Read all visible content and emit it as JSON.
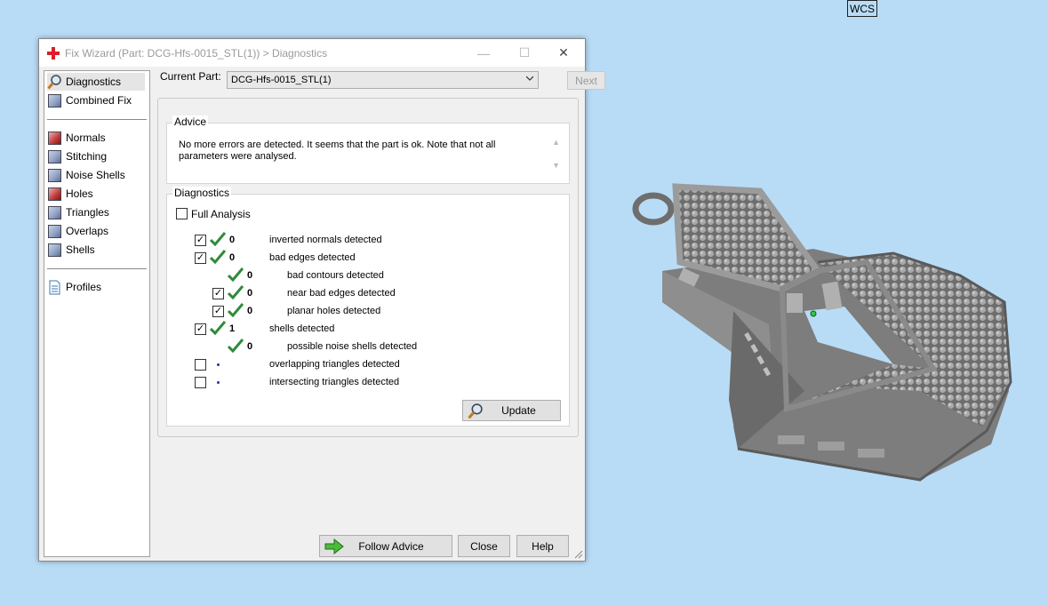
{
  "wcs_label": "WCS",
  "window": {
    "title": "Fix Wizard (Part: DCG-Hfs-0015_STL(1)) > Diagnostics",
    "minimize_glyph": "—",
    "maximize_glyph": "☐",
    "close_glyph": "✕"
  },
  "sidebar": {
    "items": [
      {
        "label": "Diagnostics",
        "icon": "magnifier-icon"
      },
      {
        "label": "Combined Fix",
        "icon": "cube-icon"
      },
      {
        "label": "Normals",
        "icon": "red-cube-icon"
      },
      {
        "label": "Stitching",
        "icon": "cube-icon"
      },
      {
        "label": "Noise Shells",
        "icon": "cube-icon"
      },
      {
        "label": "Holes",
        "icon": "red-cube-icon"
      },
      {
        "label": "Triangles",
        "icon": "cube-icon"
      },
      {
        "label": "Overlaps",
        "icon": "cube-icon"
      },
      {
        "label": "Shells",
        "icon": "cube-icon"
      },
      {
        "label": "Profiles",
        "icon": "document-icon"
      }
    ]
  },
  "current_part": {
    "label": "Current Part:",
    "value": "DCG-Hfs-0015_STL(1)",
    "next_label": "Next"
  },
  "advice": {
    "title": "Advice",
    "text": "No more errors are detected. It seems that the part is ok. Note that not all parameters were analysed."
  },
  "diagnostics": {
    "title": "Diagnostics",
    "full_analysis_label": "Full Analysis",
    "rows": [
      {
        "count": "0",
        "label": "inverted normals detected",
        "checked": true,
        "status": "ok"
      },
      {
        "count": "0",
        "label": "bad edges detected",
        "checked": true,
        "status": "ok"
      },
      {
        "count": "0",
        "label": "bad contours detected",
        "checked": null,
        "status": "ok"
      },
      {
        "count": "0",
        "label": "near bad edges detected",
        "checked": true,
        "status": "ok"
      },
      {
        "count": "0",
        "label": "planar holes detected",
        "checked": true,
        "status": "ok"
      },
      {
        "count": "1",
        "label": "shells detected",
        "checked": true,
        "status": "ok"
      },
      {
        "count": "0",
        "label": "possible noise shells detected",
        "checked": null,
        "status": "ok"
      },
      {
        "count": "",
        "label": "overlapping triangles detected",
        "checked": false,
        "status": "pending"
      },
      {
        "count": "",
        "label": "intersecting triangles detected",
        "checked": false,
        "status": "pending"
      }
    ],
    "update_label": "Update"
  },
  "footer": {
    "follow_advice_label": "Follow Advice",
    "close_label": "Close",
    "help_label": "Help"
  },
  "colors": {
    "background": "#b9dcf6",
    "check_green": "#2e8b3a",
    "model_gray": "#7a7a7a"
  }
}
